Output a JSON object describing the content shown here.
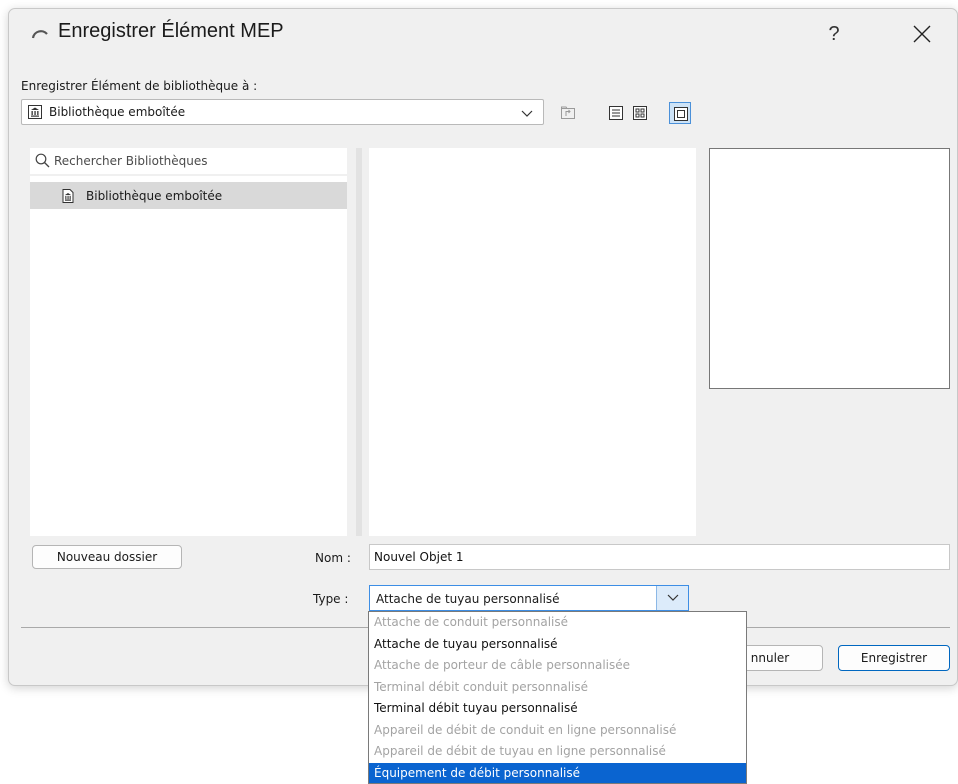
{
  "dialog": {
    "title": "Enregistrer Élément MEP",
    "help": "?",
    "save_to_label": "Enregistrer Élément de bibliothèque à :",
    "library_select": "Bibliothèque emboîtée",
    "search_placeholder": "Rechercher Bibliothèques",
    "tree_items": [
      {
        "label": "Bibliothèque emboîtée"
      }
    ],
    "new_folder_button": "Nouveau dossier",
    "name_label": "Nom :",
    "name_value": "Nouvel Objet 1",
    "type_label": "Type :",
    "type_value": "Attache de tuyau personnalisé",
    "cancel_button": "nnuler",
    "save_button": "Enregistrer"
  },
  "type_dropdown": {
    "options": [
      {
        "label": "Attache de conduit personnalisé",
        "state": "disabled"
      },
      {
        "label": "Attache de tuyau personnalisé",
        "state": "enabled"
      },
      {
        "label": "Attache de porteur de câble personnalisée",
        "state": "disabled"
      },
      {
        "label": "Terminal débit conduit personnalisé",
        "state": "disabled"
      },
      {
        "label": "Terminal débit tuyau personnalisé",
        "state": "enabled"
      },
      {
        "label": "Appareil de débit de conduit en ligne personnalisé",
        "state": "disabled"
      },
      {
        "label": "Appareil de débit de tuyau en ligne personnalisé",
        "state": "disabled"
      },
      {
        "label": "Équipement de débit personnalisé",
        "state": "selected"
      }
    ]
  },
  "colors": {
    "accent": "#0a64d0",
    "focus_border": "#3d8ee5",
    "disabled_text": "#a3a3a3",
    "dialog_bg": "#f0f0f0"
  },
  "icons": {
    "app": "archicad-arc-icon",
    "library": "library-building-icon",
    "search": "search-icon",
    "folder_up": "folder-up-icon",
    "list_view": "list-view-icon",
    "grid_view": "grid-view-icon",
    "preview_view": "preview-view-icon",
    "dropdown": "chevron-down-icon",
    "close": "close-icon"
  }
}
